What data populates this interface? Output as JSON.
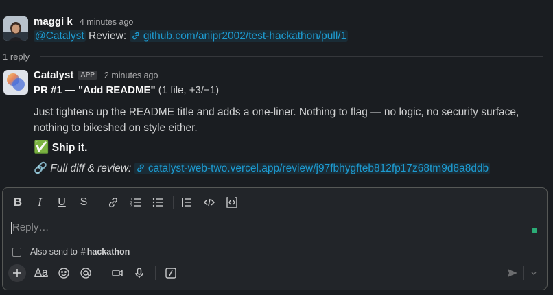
{
  "message1": {
    "author": "maggi k",
    "time": "4 minutes ago",
    "mention": "@Catalyst",
    "text": "Review:",
    "link": "github.com/anipr2002/test-hackathon/pull/1"
  },
  "thread": {
    "reply_count": "1 reply"
  },
  "message2": {
    "author": "Catalyst",
    "badge": "APP",
    "time": "2 minutes ago",
    "pr_title": "PR #1 — \"Add README\"",
    "pr_meta": "(1 file, +3/−1)",
    "body": "Just tightens up the README title and adds a one-liner. Nothing to flag — no logic, no security surface, nothing to bikeshed on style either.",
    "ship_emoji": "✅",
    "ship_text": "Ship it.",
    "diff_emoji": "🔗",
    "diff_label": "Full diff & review:",
    "diff_link": "catalyst-web-two.vercel.app/review/j97fbhygfteb812fp17z68tm9d8a8ddb"
  },
  "composer": {
    "placeholder": "Reply…",
    "also_send_label": "Also send to",
    "channel_hash": "#",
    "channel": "hackathon"
  },
  "colors": {
    "accent": "#1d9bd1",
    "online": "#2bac76",
    "background": "#1a1d21"
  }
}
